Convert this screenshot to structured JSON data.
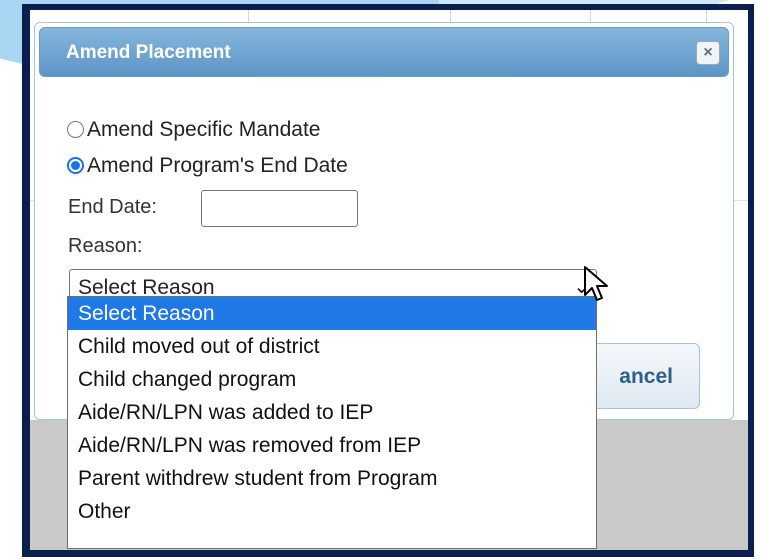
{
  "dialog": {
    "title": "Amend Placement",
    "close_icon": "close-icon",
    "options": [
      {
        "label": "Amend Specific Mandate",
        "checked": false
      },
      {
        "label": "Amend Program's End Date",
        "checked": true
      }
    ],
    "end_date_label": "End Date:",
    "end_date_value": "",
    "reason_label": "Reason:",
    "reason_selected": "Select Reason",
    "cancel_label": "ancel"
  },
  "dropdown": {
    "items": [
      "Select Reason",
      "Child moved out of district",
      "Child changed program",
      "Aide/RN/LPN was added to IEP",
      "Aide/RN/LPN was removed from IEP",
      "Parent withdrew student from Program",
      "Other"
    ],
    "highlighted_index": 0
  },
  "colors": {
    "titlebar": "#6fa3d1",
    "highlight": "#1e78e6",
    "frame": "#0b1f4e"
  }
}
